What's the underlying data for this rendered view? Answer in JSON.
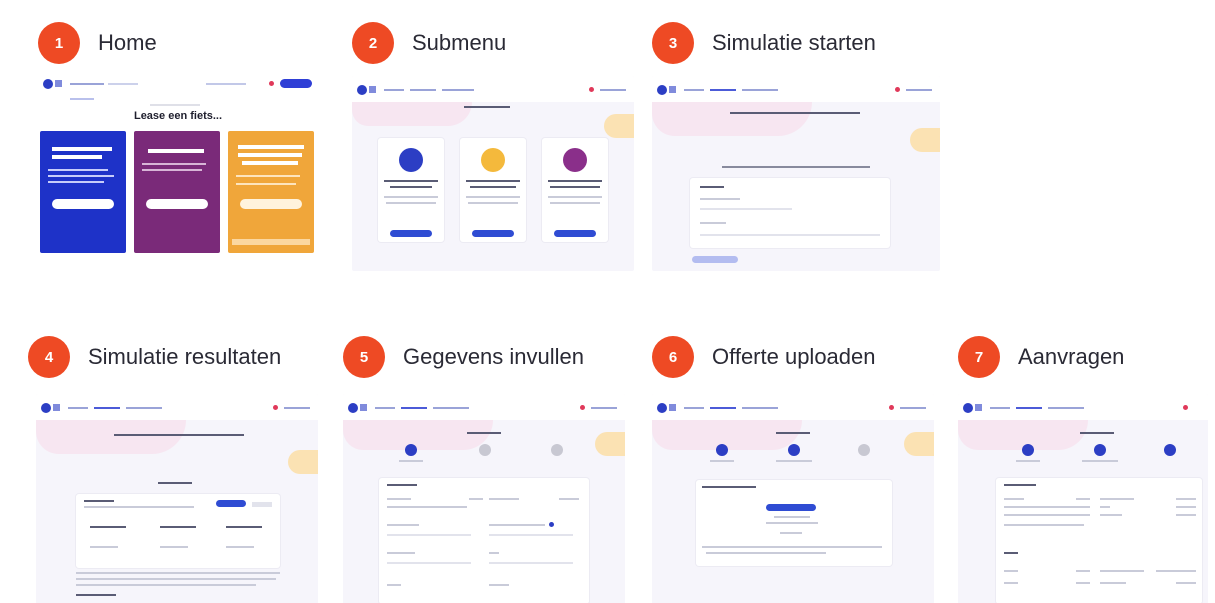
{
  "steps": [
    {
      "number": "1",
      "title": "Home"
    },
    {
      "number": "2",
      "title": "Submenu"
    },
    {
      "number": "3",
      "title": "Simulatie starten"
    },
    {
      "number": "4",
      "title": "Simulatie resultaten"
    },
    {
      "number": "5",
      "title": "Gegevens invullen"
    },
    {
      "number": "6",
      "title": "Offerte uploaden"
    },
    {
      "number": "7",
      "title": "Aanvragen"
    }
  ],
  "home_thumbnail": {
    "headline": "Lease een fiets..."
  },
  "colors": {
    "badge": "#ee4a24",
    "brand_blue": "#2c3ec4",
    "panel_blue": "#1e32c8",
    "panel_purple": "#7a2a79",
    "panel_orange": "#f0a63a"
  }
}
